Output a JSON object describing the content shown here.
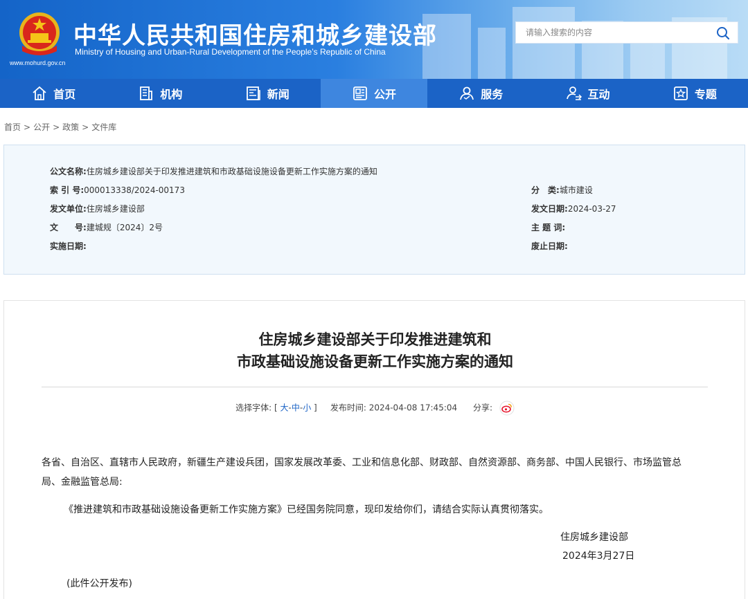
{
  "header": {
    "site_title": "中华人民共和国住房和城乡建设部",
    "site_subtitle": "Ministry of Housing and Urban-Rural Development of the People’s Republic of China",
    "site_url": "www.mohurd.gov.cn",
    "search_placeholder": "请输入搜索的内容"
  },
  "nav": {
    "items": [
      {
        "label": "首页",
        "icon": "home-icon"
      },
      {
        "label": "机构",
        "icon": "building-icon"
      },
      {
        "label": "新闻",
        "icon": "news-icon"
      },
      {
        "label": "公开",
        "icon": "disclosure-icon",
        "active": true
      },
      {
        "label": "服务",
        "icon": "service-icon"
      },
      {
        "label": "互动",
        "icon": "interact-icon"
      },
      {
        "label": "专题",
        "icon": "star-icon"
      }
    ]
  },
  "breadcrumb": [
    "首页",
    "公开",
    "政策",
    "文件库"
  ],
  "breadcrumb_sep": ">",
  "meta": {
    "doc_name_label": "公文名称:",
    "doc_name": "住房城乡建设部关于印发推进建筑和市政基础设施设备更新工作实施方案的通知",
    "index_label": "索 引 号:",
    "index": "000013338/2024-00173",
    "category_label": "分　类:",
    "category": "城市建设",
    "issuer_label": "发文单位:",
    "issuer": "住房城乡建设部",
    "issue_date_label": "发文日期:",
    "issue_date": "2024-03-27",
    "doc_no_label": "文　　号:",
    "doc_no": "建城规〔2024〕2号",
    "keywords_label": "主 题 词:",
    "keywords": "",
    "effective_label": "实施日期:",
    "effective": "",
    "abolish_label": "废止日期:",
    "abolish": ""
  },
  "article": {
    "title_line1": "住房城乡建设部关于印发推进建筑和",
    "title_line2": "市政基础设施设备更新工作实施方案的通知",
    "font_size_label": "选择字体:",
    "bracket_open": "[",
    "size_large": "大",
    "size_medium": "中",
    "size_small": "小",
    "dash": "-",
    "bracket_close": "]",
    "publish_label": "发布时间:",
    "publish_time": "2024-04-08 17:45:04",
    "share_label": "分享:",
    "recipients_line1": "各省、自治区、直辖市人民政府，新疆生产建设兵团，国家发展改革委、工业和信息化部、财政部、自然资源部、商务部、中国人民银行、市场监管总",
    "recipients_line2": "局、金融监管总局:",
    "body": "《推进建筑和市政基础设施设备更新工作实施方案》已经国务院同意，现印发给你们，请结合实际认真贯彻落实。",
    "signature": "住房城乡建设部",
    "sign_date": "2024年3月27日",
    "note": "(此件公开发布)"
  },
  "colors": {
    "nav_bg": "#1b63c6",
    "nav_active": "#3e86df",
    "meta_bg": "#f2f8fd",
    "link": "#1b63c6"
  }
}
